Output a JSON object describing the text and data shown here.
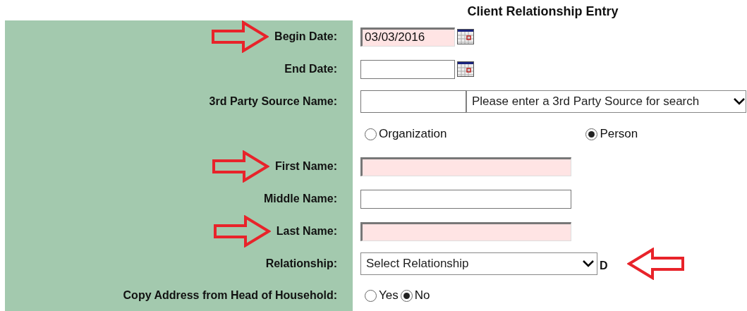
{
  "title": "Client Relationship Entry",
  "rows": [
    {
      "kind": "date",
      "label": "Begin Date:",
      "value": "03/03/2016",
      "required": true,
      "arrow_before_label": true,
      "arrow_after_field": false
    },
    {
      "kind": "date",
      "label": "End Date:",
      "required": false,
      "arrow_before_label": false,
      "arrow_after_field": false
    },
    {
      "kind": "text-select",
      "label": "3rd Party Source Name:",
      "select": "Please enter a 3rd Party Source for search",
      "required": false,
      "arrow_before_label": false,
      "arrow_after_field": false
    },
    {
      "kind": "radio-spread",
      "options": [
        {
          "label": "Organization",
          "selected": false
        },
        {
          "label": "Person",
          "selected": true
        }
      ],
      "arrow_before_label": false,
      "arrow_after_field": false
    },
    {
      "kind": "text",
      "label": "First Name:",
      "required": true,
      "arrow_before_label": true,
      "arrow_after_field": false
    },
    {
      "kind": "text",
      "label": "Middle Name:",
      "required": false,
      "arrow_before_label": false,
      "arrow_after_field": false
    },
    {
      "kind": "text",
      "label": "Last Name:",
      "required": true,
      "arrow_before_label": true,
      "arrow_after_field": false
    },
    {
      "kind": "select",
      "label": "Relationship:",
      "select": "Select Relationship",
      "suffix": "D",
      "arrow_before_label": false,
      "arrow_after_field": true
    },
    {
      "kind": "radio",
      "label": "Copy Address from Head of Household:",
      "options": [
        {
          "label": "Yes",
          "selected": false
        },
        {
          "label": "No",
          "selected": true
        }
      ],
      "arrow_before_label": false,
      "arrow_after_field": false
    }
  ]
}
